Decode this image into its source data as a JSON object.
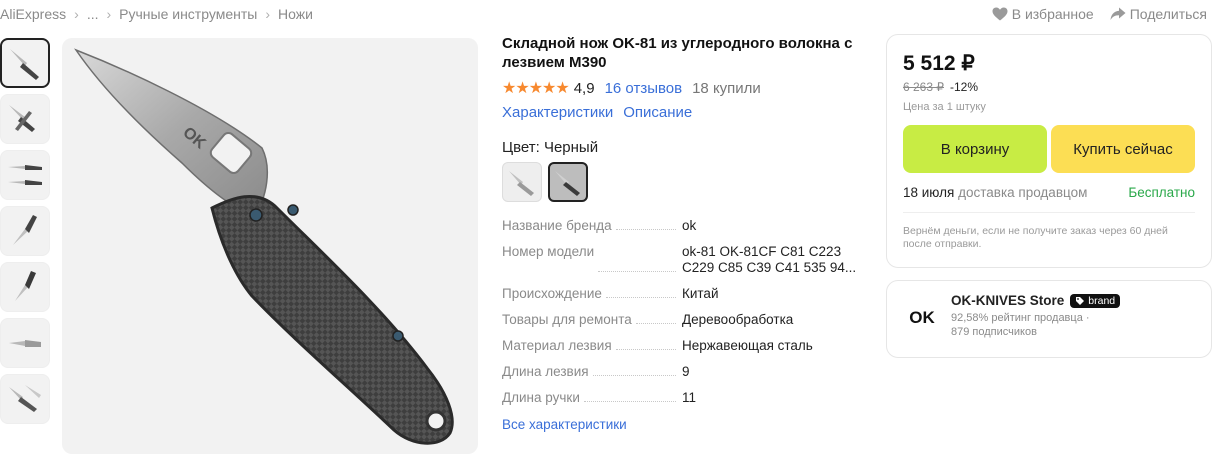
{
  "breadcrumb": [
    "AliExpress",
    "...",
    "Ручные инструменты",
    "Ножи"
  ],
  "top_actions": {
    "favorite": "В избранное",
    "share": "Поделиться"
  },
  "product": {
    "title": "Складной нож OK-81 из углеродного волокна с лезвием M390",
    "stars": "★★★★★",
    "rating": "4,9",
    "reviews": "16 отзывов",
    "bought": "18 купили",
    "tabs": [
      "Характеристики",
      "Описание"
    ],
    "color_label": "Цвет: Черный",
    "specs": [
      {
        "name": "Название бренда",
        "value": "ok"
      },
      {
        "name": "Номер модели",
        "value": "ok-81 OK-81CF C81 C223 C229 C85 C39 C41 535 94..."
      },
      {
        "name": "Происхождение",
        "value": "Китай"
      },
      {
        "name": "Товары для ремонта",
        "value": "Деревообработка"
      },
      {
        "name": "Материал лезвия",
        "value": "Нержавеющая сталь"
      },
      {
        "name": "Длина лезвия",
        "value": "9"
      },
      {
        "name": "Длина ручки",
        "value": "11"
      }
    ],
    "all_specs": "Все характеристики"
  },
  "buybox": {
    "price": "5 512 ₽",
    "old_price": "6 263 ₽",
    "discount": "-12%",
    "per_unit": "Цена за 1 штуку",
    "cart_label": "В корзину",
    "buy_label": "Купить сейчас",
    "delivery_date": "18 июля",
    "delivery_text": "доставка продавцом",
    "delivery_price": "Бесплатно",
    "guarantee": "Вернём деньги, если не получите заказ через 60 дней после отправки."
  },
  "store": {
    "logo": "OK",
    "name": "OK-KNIVES Store",
    "badge": "brand",
    "rating": "92,58% рейтинг продавца",
    "followers": "879 подписчиков"
  },
  "colors": {
    "link": "#3a6fd8",
    "star": "#f7892f",
    "cart": "#c8ec44",
    "buy": "#fcde54",
    "free": "#2aa84a"
  },
  "icons": [
    "heart-icon",
    "share-icon",
    "star-icon",
    "brand-tag-icon"
  ]
}
